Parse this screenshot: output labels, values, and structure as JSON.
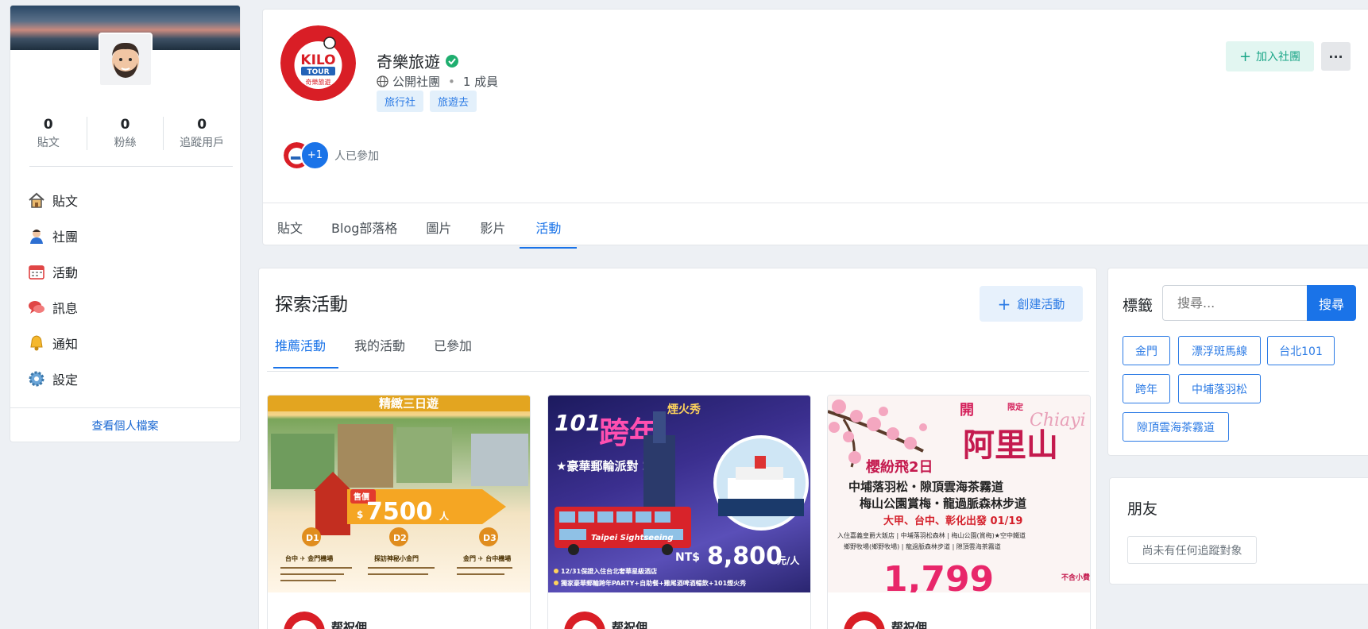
{
  "profile": {
    "stats": [
      {
        "value": "0",
        "label": "貼文"
      },
      {
        "value": "0",
        "label": "粉絲"
      },
      {
        "value": "0",
        "label": "追蹤用戶"
      }
    ],
    "nav": [
      {
        "label": "貼文",
        "icon": "house-icon"
      },
      {
        "label": "社團",
        "icon": "person-icon"
      },
      {
        "label": "活動",
        "icon": "calendar-icon"
      },
      {
        "label": "訊息",
        "icon": "chat-icon"
      },
      {
        "label": "通知",
        "icon": "bell-icon"
      },
      {
        "label": "設定",
        "icon": "gear-icon"
      }
    ],
    "view_profile": "查看個人檔案"
  },
  "group": {
    "name": "奇樂旅遊",
    "privacy": "公開社團",
    "member_count": "1 成員",
    "tags": [
      "旅行社",
      "旅遊去"
    ],
    "join_label": "加入社團",
    "more_label": "···",
    "plus_count": "+1",
    "joined_label": "人已參加",
    "logo_text": "KILO",
    "logo_sub": "TOUR",
    "logo_cn": "奇樂旅遊",
    "tabs": [
      "貼文",
      "Blog部落格",
      "圖片",
      "影片",
      "活動"
    ],
    "active_tab": 4
  },
  "events": {
    "title": "探索活動",
    "create_label": "創建活動",
    "tabs": [
      "推薦活動",
      "我的活動",
      "已參加"
    ],
    "active_tab": 0,
    "cards": [
      {
        "org": "帮祝佣",
        "poster": {
          "headline": "精緻三日遊",
          "price_label": "售價",
          "price_currency": "$",
          "price": "7500",
          "price_unit": "人",
          "days": [
            "D1",
            "D2",
            "D3"
          ],
          "day_titles": [
            "台中 ✈ 金門機場",
            "探訪神秘小金門",
            "金門 ✈ 台中機場"
          ]
        }
      },
      {
        "org": "帮祝佣",
        "poster": {
          "headline_a": "101",
          "headline_b": "跨年",
          "headline_c": "煙火秀",
          "sub": "★豪華郵輪派對 2日",
          "bus_text": "Taipei Sightseeing",
          "price_prefix": "NT$",
          "price": "8,800",
          "price_unit": "元/人",
          "note_1": "12/31保證入住台北奢華星級酒店",
          "note_2": "獨家豪華郵輪跨年PARTY+自助餐+雞尾酒啤酒暢飲+101煙火秀"
        }
      },
      {
        "org": "帮祝佣",
        "poster": {
          "limited": "限定",
          "open": "開",
          "chiayi": "Chiayi",
          "big": "阿里山",
          "line_1": "櫻紛飛2日",
          "line_2": "中埔落羽松・隙頂雲海茶霧道",
          "line_3": "梅山公園賞梅・龍過脈森林步道",
          "departure": "大甲、台中、彰化出發 01/19",
          "detail_1": "入住嘉義皇爵大飯店 | 中埔落羽松森林 | 梅山公園(賞梅)★空中鐵道",
          "detail_2": "鄉野牧場(鄉野牧場) | 龍過脈森林步道 | 隙頂雲海茶霧道",
          "price": "1,799",
          "price_note": "不含小費"
        }
      }
    ]
  },
  "tags_panel": {
    "title": "標籤",
    "search_placeholder": "搜尋...",
    "search_label": "搜尋",
    "chips": [
      "金門",
      "漂浮斑馬線",
      "台北101",
      "跨年",
      "中埔落羽松",
      "隙頂雲海茶霧道"
    ]
  },
  "friends": {
    "title": "朋友",
    "empty": "尚未有任何追蹤對象"
  },
  "colors": {
    "accent": "#1a73e8",
    "join_green": "#1aa587",
    "verified": "#1fae6f"
  }
}
